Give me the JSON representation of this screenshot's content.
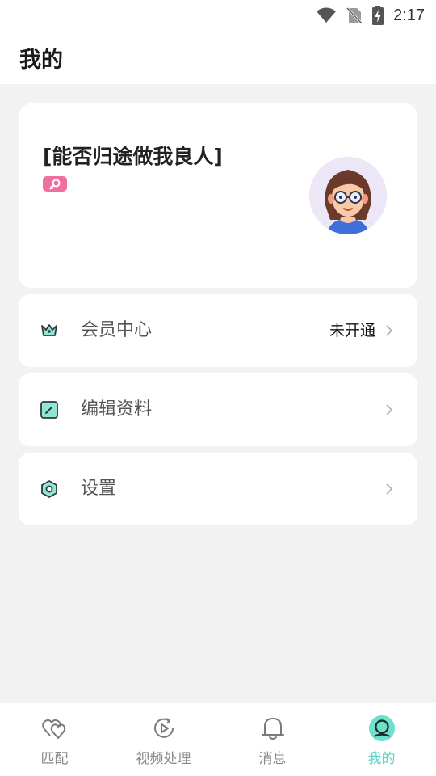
{
  "status_bar": {
    "time": "2:17"
  },
  "header": {
    "title": "我的"
  },
  "profile": {
    "nickname": "[能否归途做我良人]",
    "gender": "female"
  },
  "menu": [
    {
      "label": "会员中心",
      "value": "未开通",
      "icon": "crown-icon"
    },
    {
      "label": "编辑资料",
      "value": "",
      "icon": "edit-icon"
    },
    {
      "label": "设置",
      "value": "",
      "icon": "settings-icon"
    }
  ],
  "tabs": [
    {
      "label": "匹配",
      "icon": "hearts-icon",
      "active": false
    },
    {
      "label": "视频处理",
      "icon": "video-process-icon",
      "active": false
    },
    {
      "label": "消息",
      "icon": "bell-icon",
      "active": false
    },
    {
      "label": "我的",
      "icon": "profile-icon",
      "active": true
    }
  ],
  "colors": {
    "accent": "#5ed8c2",
    "badge_pink": "#f06fa0",
    "background": "#f2f2f2"
  }
}
